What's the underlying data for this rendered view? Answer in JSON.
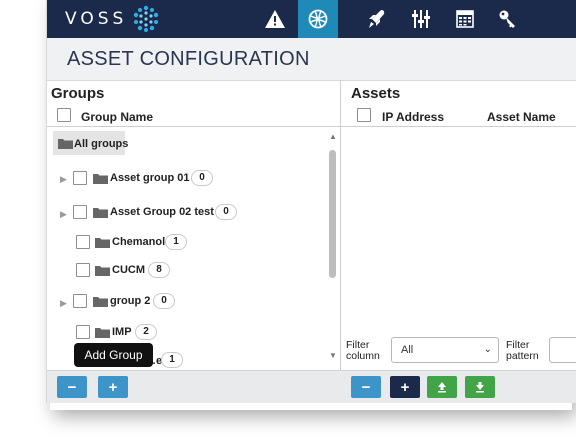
{
  "brand": {
    "name": "VOSS"
  },
  "nav": [
    {
      "id": "alert",
      "icon": "warning-icon"
    },
    {
      "id": "network",
      "icon": "globe-icon",
      "active": true
    },
    {
      "id": "rocket",
      "icon": "rocket-icon"
    },
    {
      "id": "sliders",
      "icon": "sliders-icon"
    },
    {
      "id": "calendar",
      "icon": "calendar-icon"
    },
    {
      "id": "key",
      "icon": "key-icon"
    }
  ],
  "page": {
    "title": "ASSET CONFIGURATION"
  },
  "groups_panel": {
    "title": "Groups",
    "column": "Group Name",
    "items": [
      {
        "label": "All groups",
        "count": null,
        "expandable": false,
        "checkbox": false,
        "selected": true
      },
      {
        "label": "Asset group 01",
        "count": "0",
        "expandable": true,
        "checkbox": true
      },
      {
        "label": "Asset Group 02 test",
        "count": "0",
        "expandable": true,
        "checkbox": true
      },
      {
        "label": "Chemanol",
        "count": "1",
        "expandable": false,
        "checkbox": true
      },
      {
        "label": "CUCM",
        "count": "8",
        "expandable": false,
        "checkbox": true
      },
      {
        "label": "group 2",
        "count": "0",
        "expandable": true,
        "checkbox": true
      },
      {
        "label": "IMP",
        "count": "2",
        "expandable": false,
        "checkbox": true
      },
      {
        "label": "…e",
        "count": "1",
        "expandable": false,
        "checkbox": true
      }
    ],
    "tooltip": "Add Group"
  },
  "assets_panel": {
    "title": "Assets",
    "columns": [
      "IP Address",
      "Asset Name"
    ],
    "filter": {
      "column_label": "Filter column",
      "column_label_line1": "Filter",
      "column_label_line2": "column",
      "column_value": "All",
      "pattern_label_line1": "Filter",
      "pattern_label_line2": "pattern"
    }
  },
  "colors": {
    "topbar": "#1b2a4b",
    "active_nav": "#1f89b8",
    "button_blue": "#3d94c9",
    "button_navy": "#1b2a4b",
    "button_green": "#41a447"
  },
  "toolbar": {
    "groups": {
      "remove": "−",
      "add": "+"
    },
    "assets": {
      "remove": "−",
      "add": "+",
      "upload": "⇧",
      "download": "⇩"
    }
  }
}
